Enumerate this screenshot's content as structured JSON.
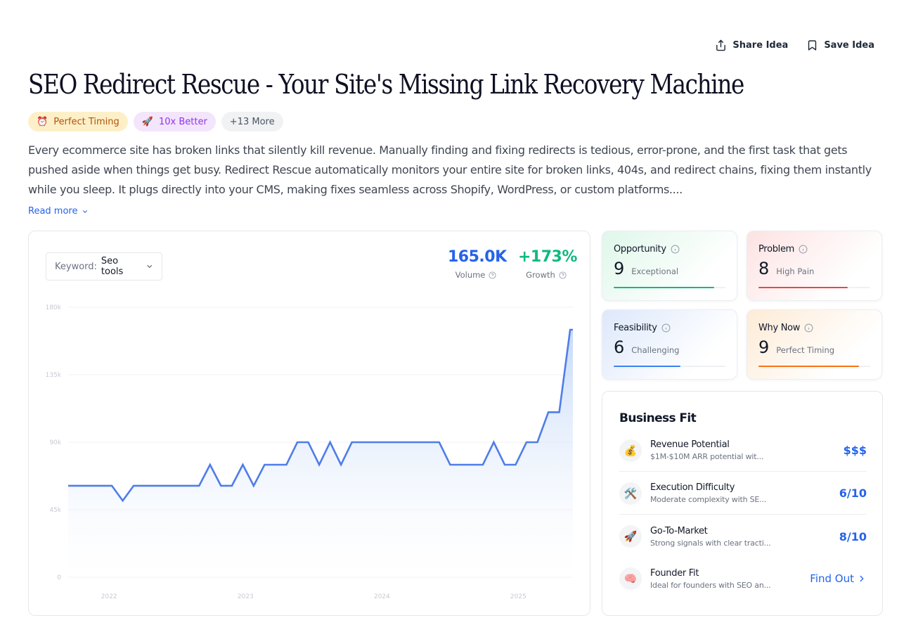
{
  "actions": {
    "share": "Share Idea",
    "save": "Save Idea"
  },
  "title": "SEO Redirect Rescue - Your Site's Missing Link Recovery Machine",
  "tags": [
    {
      "emoji": "⏰",
      "label": "Perfect Timing"
    },
    {
      "emoji": "🚀",
      "label": "10x Better"
    },
    {
      "emoji": "",
      "label": "+13 More"
    }
  ],
  "description": "Every ecommerce site has broken links that silently kill revenue. Manually finding and fixing redirects is tedious, error-prone, and the first task that gets pushed aside when things get busy. Redirect Rescue automatically monitors your entire site for broken links, 404s, and redirect chains, fixing them instantly while you sleep. It plugs directly into your CMS, making fixes seamless across Shopify, WordPress, or custom platforms....",
  "read_more": "Read more",
  "keyword": {
    "label": "Keyword:",
    "value": "Seo tools"
  },
  "metrics": {
    "volume": {
      "value": "165.0K",
      "label": "Volume"
    },
    "growth": {
      "value": "+173%",
      "label": "Growth"
    }
  },
  "chart_data": {
    "type": "area",
    "y_ticks": [
      "180k",
      "135k",
      "90k",
      "45k",
      "0"
    ],
    "x_ticks": [
      "2022",
      "2023",
      "2024",
      "2025"
    ],
    "ylim": [
      0,
      180000
    ],
    "xlim": [
      2021.7,
      2025.4
    ],
    "color": "#4f7de8",
    "grid": true,
    "series": [
      {
        "x": [
          2021.7,
          2021.78,
          2021.86,
          2021.94,
          2022.02,
          2022.1,
          2022.18,
          2022.26,
          2022.34,
          2022.42,
          2022.5,
          2022.58,
          2022.66,
          2022.74,
          2022.82,
          2022.9,
          2022.98,
          2023.06,
          2023.14,
          2023.22,
          2023.3,
          2023.38,
          2023.46,
          2023.54,
          2023.62,
          2023.7,
          2023.78,
          2023.86,
          2023.94,
          2024.02,
          2024.1,
          2024.18,
          2024.26,
          2024.34,
          2024.42,
          2024.5,
          2024.58,
          2024.66,
          2024.74,
          2024.82,
          2024.9,
          2024.98,
          2025.06,
          2025.14,
          2025.22,
          2025.3,
          2025.38,
          2025.4
        ],
        "values": [
          61000,
          61000,
          61000,
          61000,
          61000,
          51000,
          61000,
          61000,
          61000,
          61000,
          61000,
          61000,
          61000,
          75000,
          61000,
          61000,
          75000,
          61000,
          75000,
          75000,
          75000,
          90000,
          90000,
          75000,
          90000,
          75000,
          90000,
          90000,
          90000,
          90000,
          90000,
          90000,
          90000,
          90000,
          90000,
          75000,
          75000,
          75000,
          75000,
          90000,
          75000,
          75000,
          90000,
          90000,
          110000,
          110000,
          165000,
          165000
        ]
      }
    ]
  },
  "scores": [
    {
      "key": "opp",
      "title": "Opportunity",
      "score": "9",
      "label": "Exceptional",
      "value": 9,
      "color": "#10b981"
    },
    {
      "key": "prob",
      "title": "Problem",
      "score": "8",
      "label": "High Pain",
      "value": 8,
      "color": "#ef4444"
    },
    {
      "key": "feas",
      "title": "Feasibility",
      "score": "6",
      "label": "Challenging",
      "value": 6,
      "color": "#3b82f6"
    },
    {
      "key": "why",
      "title": "Why Now",
      "score": "9",
      "label": "Perfect Timing",
      "value": 9,
      "color": "#f97316"
    }
  ],
  "business_fit": {
    "title": "Business Fit",
    "items": [
      {
        "icon": "💰",
        "icon_name": "money-bag-icon",
        "title": "Revenue Potential",
        "sub": "$1M-$10M ARR potential wit...",
        "value": "$$$"
      },
      {
        "icon": "🛠️",
        "icon_name": "tools-icon",
        "title": "Execution Difficulty",
        "sub": "Moderate complexity with SE...",
        "value": "6/10"
      },
      {
        "icon": "🚀",
        "icon_name": "rocket-icon",
        "title": "Go-To-Market",
        "sub": "Strong signals with clear tracti...",
        "value": "8/10"
      },
      {
        "icon": "🧠",
        "icon_name": "brain-icon",
        "title": "Founder Fit",
        "sub": "Ideal for founders with SEO an...",
        "value": "Find Out"
      }
    ]
  }
}
